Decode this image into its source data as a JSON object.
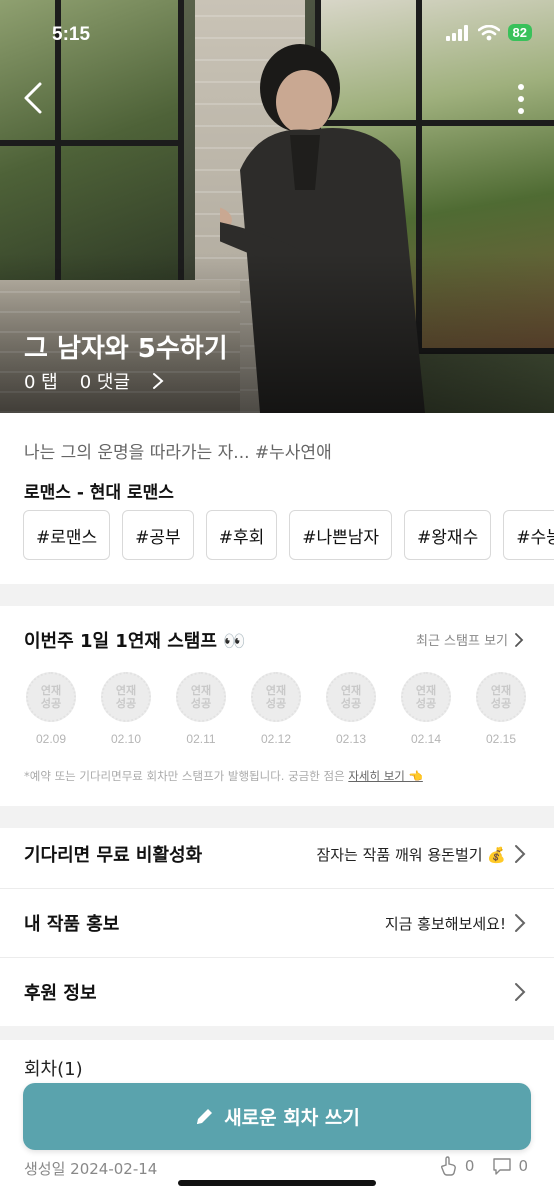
{
  "status_bar": {
    "time": "5:15",
    "battery": "82"
  },
  "hero": {
    "title": "그 남자와 5수하기",
    "taps": "0 탭",
    "comments": "0 댓글"
  },
  "synopsis": "나는 그의 운명을 따라가는 자... #누사연애",
  "genre": "로맨스 - 현대 로맨스",
  "tags": [
    "#로맨스",
    "#공부",
    "#후회",
    "#나쁜남자",
    "#왕재수",
    "#수능"
  ],
  "stamps": {
    "title": "이번주 1일 1연재 스탬프 👀",
    "link_label": "최근 스탬프 보기",
    "badge_line1": "연재",
    "badge_line2": "성공",
    "dates": [
      "02.09",
      "02.10",
      "02.11",
      "02.12",
      "02.13",
      "02.14",
      "02.15"
    ],
    "note": "*예약 또는 기다리면무료 회차만 스탬프가 발행됩니다. 궁금한 점은 ",
    "note_link": "자세히 보기 👈"
  },
  "rows": [
    {
      "label": "기다리면 무료 비활성화",
      "right": "잠자는 작품 깨워 용돈벌기 💰"
    },
    {
      "label": "내 작품 홍보",
      "right": "지금 홍보해보세요!"
    },
    {
      "label": "후원 정보",
      "right": ""
    }
  ],
  "episodes": "회차(1)",
  "fab_label": "새로운 회차 쓰기",
  "created": "생성일 2024-02-14",
  "metrics": {
    "taps": "0",
    "comments": "0"
  }
}
